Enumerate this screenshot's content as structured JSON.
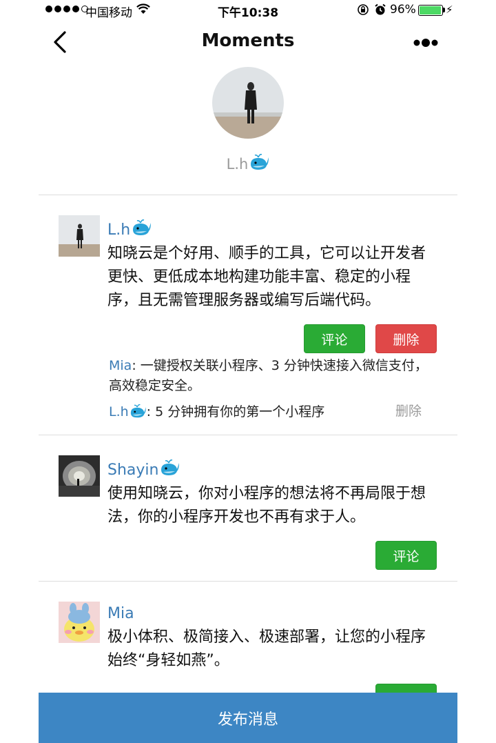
{
  "status_bar": {
    "carrier": "中国移动",
    "time": "下午10:38",
    "battery_percent": "96%",
    "battery_level": 0.96,
    "icons": [
      "signal-dots-icon",
      "wifi-icon",
      "orientation-lock-icon",
      "alarm-icon",
      "battery-icon",
      "charging-bolt-icon"
    ]
  },
  "nav": {
    "title": "Moments",
    "back_icon": "chevron-left-icon",
    "more_icon": "more-dots-icon"
  },
  "profile": {
    "name": "L.h",
    "name_emoji": "whale-icon"
  },
  "posts": [
    {
      "author": "L.h",
      "author_emoji": "whale-icon",
      "content": "知晓云是个好用、顺手的工具，它可以让开发者更快、更低成本地构建功能丰富、稳定的小程序，且无需管理服务器或编写后端代码。",
      "comment_label": "评论",
      "delete_label": "删除",
      "comments": [
        {
          "author": "Mia",
          "text": "一键授权关联小程序、3 分钟快速接入微信支付，高效稳定安全。"
        },
        {
          "author": "L.h",
          "author_emoji": "whale-icon",
          "text": "5 分钟拥有你的第一个小程序",
          "delete_label": "删除"
        }
      ]
    },
    {
      "author": "Shayin",
      "author_emoji": "whale-icon",
      "content": "使用知晓云，你对小程序的想法将不再局限于想法，你的小程序开发也不再有求于人。",
      "comment_label": "评论"
    },
    {
      "author": "Mia",
      "content": "极小体积、极简接入、极速部署，让您的小程序始终“身轻如燕”。"
    }
  ],
  "comment_separator": ": ",
  "publish_button": "发布消息",
  "colors": {
    "link": "#3a7bb5",
    "green_button": "#2aab35",
    "red_button": "#e04848",
    "publish_bar": "#3d86c4"
  }
}
